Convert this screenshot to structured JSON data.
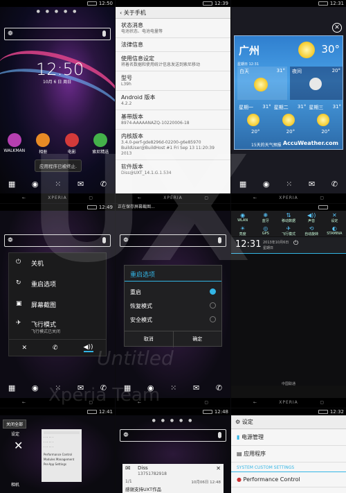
{
  "colors": {
    "accent": "#33b5e5",
    "settings_bg": "#f6f6f6",
    "weather_top": "#2f7fcf"
  },
  "watermark": {
    "brand": "UX",
    "sub1": "Untitled",
    "sub2": "Xperia Team"
  },
  "panels": {
    "home1": {
      "time": "12:50",
      "clock": "12:50",
      "date": "10月 6 日 周日",
      "dots": "● ● ● ● ●",
      "apps": [
        {
          "label": "WALKMAN",
          "color": "#b53fb0"
        },
        {
          "label": "相册",
          "color": "#e88b25"
        },
        {
          "label": "电影",
          "color": "#d43a3a"
        },
        {
          "label": "索尼精选",
          "color": "#44b14a"
        }
      ],
      "toast": "应用程序已被终止.",
      "nav_brand": "XPERIA"
    },
    "about": {
      "time": "12:39",
      "title": "关于手机",
      "rows": [
        {
          "title": "状态消息",
          "sub": "电池状态、电池电量等"
        },
        {
          "title": "法律信息",
          "sub": ""
        },
        {
          "title": "使用信息设定",
          "sub": "将着名数据和使用统计信息发送到索尼移动"
        },
        {
          "title": "型号",
          "sub": "L39h"
        },
        {
          "title": "Android 版本",
          "sub": "4.2.2"
        },
        {
          "title": "基带版本",
          "sub": "8974-AAAAANAZQ-10220006-18"
        },
        {
          "title": "内核版本",
          "sub": "3.4.0-perf-gde8296d-02200-g6e85970 BuildUser@BuildHost #1 Fri Sep 13 11:20:39 2013"
        },
        {
          "title": "软件版本",
          "sub": "Diss@UXT_14.1.G.1.534"
        }
      ],
      "nav_brand": "XPERIA"
    },
    "weather": {
      "time": "12:31",
      "city": "广州",
      "temp": "30°",
      "updated": "星期日 12:31",
      "now": {
        "label": "白天",
        "temp": "31°"
      },
      "night": {
        "label": "夜间",
        "temp": "20°"
      },
      "days": [
        {
          "d": "星期一",
          "hi": "31°",
          "lo": "20°"
        },
        {
          "d": "星期二",
          "hi": "31°",
          "lo": "20°"
        },
        {
          "d": "星期三",
          "hi": "31°",
          "lo": "20°"
        }
      ],
      "footer": "15天的天气预报",
      "brand": "AccuWeather.com",
      "nav_brand": "XPERIA"
    },
    "power": {
      "time": "12:49",
      "items": [
        {
          "icon": "⏻",
          "label": "关机",
          "sub": ""
        },
        {
          "icon": "↻",
          "label": "重启选项",
          "sub": ""
        },
        {
          "icon": "▣",
          "label": "屏幕截图",
          "sub": ""
        },
        {
          "icon": "✈",
          "label": "飞行模式",
          "sub": "飞行模式已关闭"
        }
      ],
      "bottom": [
        "✕",
        "✆",
        "◀))"
      ]
    },
    "reboot": {
      "status": "正在保存屏幕截图...",
      "title": "重启选项",
      "options": [
        "重启",
        "恢复模式",
        "安全模式"
      ],
      "cancel": "取消",
      "ok": "确定"
    },
    "quick": {
      "toggles": [
        {
          "i": "◉",
          "l": "WLAN"
        },
        {
          "i": "❋",
          "l": "蓝牙"
        },
        {
          "i": "⇅",
          "l": "移动数据"
        },
        {
          "i": "◀))",
          "l": "声音"
        },
        {
          "i": "✕",
          "l": "设定"
        },
        {
          "i": "☀",
          "l": "亮度"
        },
        {
          "i": "◎",
          "l": "GPS"
        },
        {
          "i": "✈",
          "l": "飞行模式"
        },
        {
          "i": "⟲",
          "l": "自动旋转"
        },
        {
          "i": "◐",
          "l": "STAMINA"
        }
      ],
      "clock": "12:31",
      "date": "2013年10月6日",
      "weekday": "星期日",
      "carrier": "中国联通",
      "nav_brand": "XPERIA"
    },
    "recents": {
      "time": "12:41",
      "close_all": "关闭全部",
      "items": [
        "设定",
        "相机"
      ],
      "sub_items": [
        "Performance Control",
        "Modules Management",
        "Per-App Settings"
      ]
    },
    "notify": {
      "time": "12:48",
      "sender": "Diss",
      "number": "13751782918",
      "count": "1/1",
      "date": "10月06日 12:48",
      "message": "感谢支持UXT作品"
    },
    "settings2": {
      "time": "12:32",
      "title": "设定",
      "items": [
        "电源管理",
        "应用程序"
      ],
      "section": "SYSTEM CUSTOM SETTINGS",
      "perf": "Performance Control"
    }
  }
}
